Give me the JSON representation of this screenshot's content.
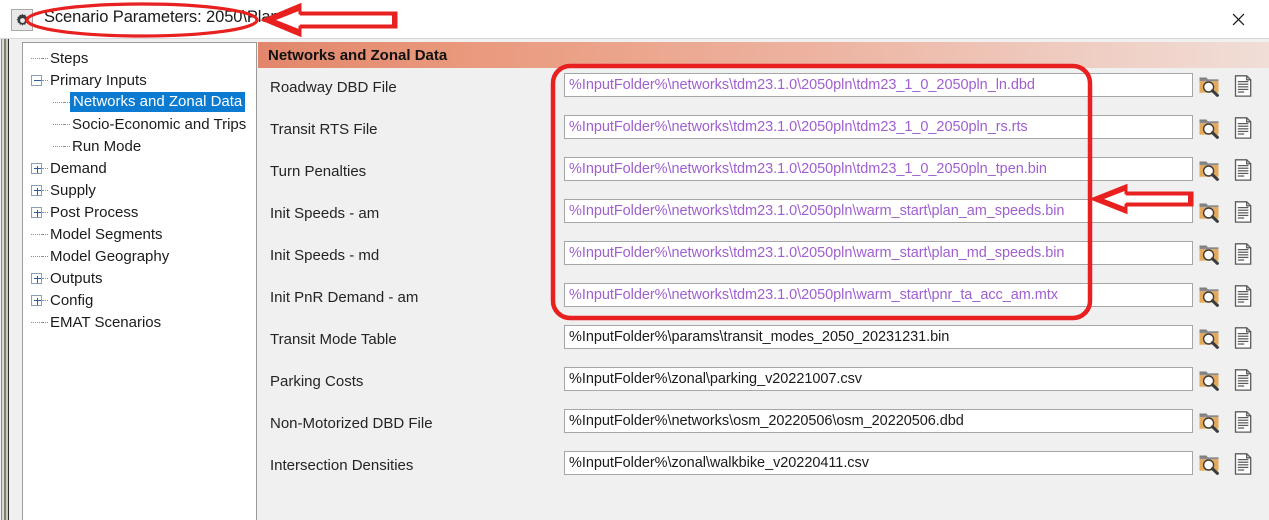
{
  "window": {
    "title": "Scenario Parameters: 2050\\Plan",
    "gear_icon": "gear-icon",
    "close_icon": "close-icon"
  },
  "sidebar": {
    "items": [
      {
        "label": "Steps",
        "indent": 1,
        "toggle": "none",
        "selected": false
      },
      {
        "label": "Primary Inputs",
        "indent": 1,
        "toggle": "minus",
        "selected": false
      },
      {
        "label": "Networks and Zonal Data",
        "indent": 2,
        "toggle": "none",
        "selected": true
      },
      {
        "label": "Socio-Economic and Trips",
        "indent": 2,
        "toggle": "none",
        "selected": false
      },
      {
        "label": "Run Mode",
        "indent": 2,
        "toggle": "none",
        "selected": false
      },
      {
        "label": "Demand",
        "indent": 1,
        "toggle": "plus",
        "selected": false
      },
      {
        "label": "Supply",
        "indent": 1,
        "toggle": "plus",
        "selected": false
      },
      {
        "label": "Post Process",
        "indent": 1,
        "toggle": "plus",
        "selected": false
      },
      {
        "label": "Model Segments",
        "indent": 1,
        "toggle": "none",
        "selected": false
      },
      {
        "label": "Model Geography",
        "indent": 1,
        "toggle": "none",
        "selected": false
      },
      {
        "label": "Outputs",
        "indent": 1,
        "toggle": "plus",
        "selected": false
      },
      {
        "label": "Config",
        "indent": 1,
        "toggle": "plus",
        "selected": false
      },
      {
        "label": "EMAT Scenarios",
        "indent": 1,
        "toggle": "none",
        "selected": false
      }
    ]
  },
  "main": {
    "header": "Networks and Zonal Data",
    "browse_icon": "folder-search-icon",
    "view_icon": "document-icon",
    "fields": [
      {
        "label": "Roadway DBD File",
        "value": "%InputFolder%\\networks\\tdm23.1.0\\2050pln\\tdm23_1_0_2050pln_ln.dbd",
        "variable": true
      },
      {
        "label": "Transit RTS File",
        "value": "%InputFolder%\\networks\\tdm23.1.0\\2050pln\\tdm23_1_0_2050pln_rs.rts",
        "variable": true
      },
      {
        "label": "Turn Penalties",
        "value": "%InputFolder%\\networks\\tdm23.1.0\\2050pln\\tdm23_1_0_2050pln_tpen.bin",
        "variable": true
      },
      {
        "label": "Init Speeds - am",
        "value": "%InputFolder%\\networks\\tdm23.1.0\\2050pln\\warm_start\\plan_am_speeds.bin",
        "variable": true
      },
      {
        "label": "Init Speeds - md",
        "value": "%InputFolder%\\networks\\tdm23.1.0\\2050pln\\warm_start\\plan_md_speeds.bin",
        "variable": true
      },
      {
        "label": "Init PnR Demand - am",
        "value": "%InputFolder%\\networks\\tdm23.1.0\\2050pln\\warm_start\\pnr_ta_acc_am.mtx",
        "variable": true
      },
      {
        "label": "Transit Mode Table",
        "value": "%InputFolder%\\params\\transit_modes_2050_20231231.bin",
        "variable": false
      },
      {
        "label": "Parking Costs",
        "value": "%InputFolder%\\zonal\\parking_v20221007.csv",
        "variable": false
      },
      {
        "label": "Non-Motorized DBD File",
        "value": "%InputFolder%\\networks\\osm_20220506\\osm_20220506.dbd",
        "variable": false
      },
      {
        "label": "Intersection Densities",
        "value": "%InputFolder%\\zonal\\walkbike_v20220411.csv",
        "variable": false
      }
    ]
  },
  "annotations": {
    "color": "#e8201f",
    "title_highlight": "oval around window title",
    "title_arrow": "arrow pointing to window title",
    "fields_highlight": "rectangle around first six file path fields",
    "fields_arrow": "arrow pointing to file path fields"
  }
}
